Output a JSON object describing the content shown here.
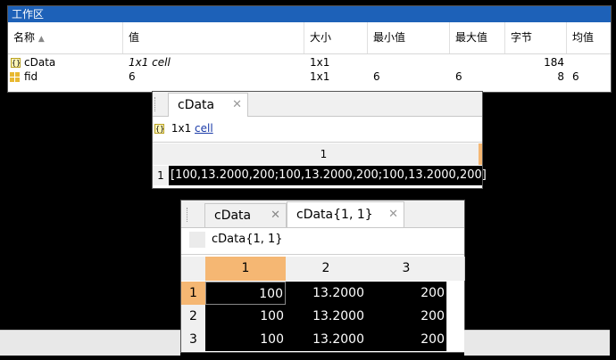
{
  "workspace": {
    "title": "工作区",
    "columns": [
      "名称",
      "值",
      "大小",
      "最小值",
      "最大值",
      "字节",
      "均值"
    ],
    "sort_indicator": "▲",
    "rows": [
      {
        "icon": "cell-icon",
        "name": "cData",
        "value": "1x1 cell",
        "size": "1x1",
        "min": "",
        "max": "",
        "bytes": "184",
        "mean": ""
      },
      {
        "icon": "matrix-icon",
        "name": "fid",
        "value": "6",
        "size": "1x1",
        "min": "6",
        "max": "6",
        "bytes": "8",
        "mean": "6"
      }
    ]
  },
  "editor1": {
    "tab_label": "cData",
    "tab_close": "✕",
    "icon_text": "{}",
    "info_size": "1x1",
    "info_type": "cell",
    "column_header": "1",
    "row_number": "1",
    "cell_value": "[100,13.2000,200;100,13.2000,200;100,13.2000,200]"
  },
  "editor2": {
    "tabs": [
      {
        "label": "cData",
        "close": "✕",
        "active": false
      },
      {
        "label": "cData{1, 1}",
        "close": "✕",
        "active": true
      }
    ],
    "breadcrumb": "cData{1, 1}",
    "column_headers": [
      "1",
      "2",
      "3"
    ],
    "rows": [
      {
        "num": "1",
        "cells": [
          "100",
          "13.2000",
          "200"
        ]
      },
      {
        "num": "2",
        "cells": [
          "100",
          "13.2000",
          "200"
        ]
      },
      {
        "num": "3",
        "cells": [
          "100",
          "13.2000",
          "200"
        ]
      }
    ]
  },
  "colors": {
    "title_bar": "#1d61b8",
    "selected_header": "#f5b773",
    "cell_bg": "#000000",
    "link": "#1a3aa8"
  }
}
